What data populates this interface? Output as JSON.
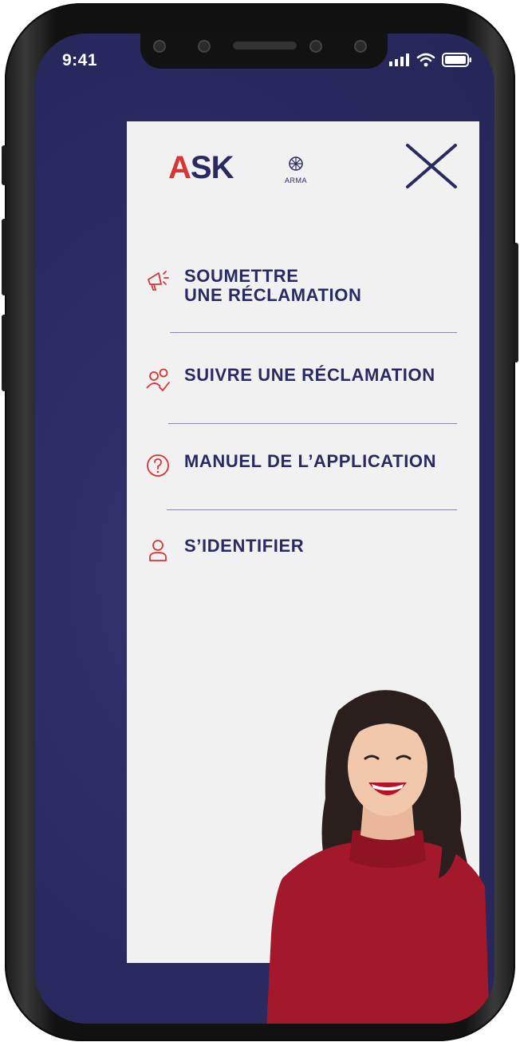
{
  "status_bar": {
    "time": "9:41"
  },
  "menu": {
    "logo_brand": "ASK",
    "logo_partner": "ARMA",
    "items": [
      {
        "label": "SOUMETTRE\nUNE RÉCLAMATION",
        "icon": "megaphone-icon"
      },
      {
        "label": "SUIVRE UNE RÉCLAMATION",
        "icon": "users-check-icon"
      },
      {
        "label": "MANUEL DE L’APPLICATION",
        "icon": "question-circle-icon"
      },
      {
        "label": "S’IDENTIFIER",
        "icon": "user-icon"
      }
    ]
  },
  "colors": {
    "primary": "#2a2a63",
    "accent": "#d83535",
    "background": "#2b2a62",
    "panel": "#f1f1f1"
  }
}
